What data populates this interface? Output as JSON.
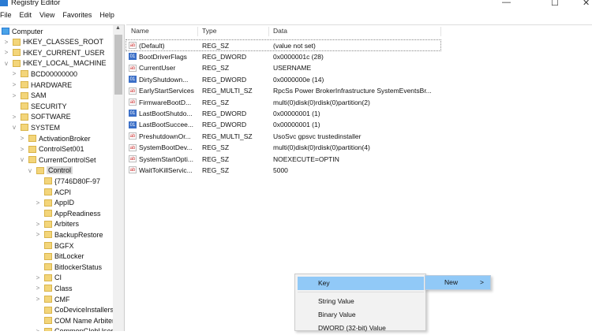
{
  "window": {
    "title": "Registry Editor",
    "minimize": "—",
    "maximize": "☐",
    "close": "✕"
  },
  "menubar": [
    "File",
    "Edit",
    "View",
    "Favorites",
    "Help"
  ],
  "tree": [
    {
      "label": "Computer",
      "level": 0,
      "chev": "",
      "computer": true
    },
    {
      "label": "HKEY_CLASSES_ROOT",
      "level": 1,
      "chev": ">"
    },
    {
      "label": "HKEY_CURRENT_USER",
      "level": 1,
      "chev": ">"
    },
    {
      "label": "HKEY_LOCAL_MACHINE",
      "level": 1,
      "chev": "v"
    },
    {
      "label": "BCD00000000",
      "level": 2,
      "chev": ">"
    },
    {
      "label": "HARDWARE",
      "level": 2,
      "chev": ">"
    },
    {
      "label": "SAM",
      "level": 2,
      "chev": ">"
    },
    {
      "label": "SECURITY",
      "level": 2,
      "chev": ""
    },
    {
      "label": "SOFTWARE",
      "level": 2,
      "chev": ">"
    },
    {
      "label": "SYSTEM",
      "level": 2,
      "chev": "v"
    },
    {
      "label": "ActivationBroker",
      "level": 3,
      "chev": ">"
    },
    {
      "label": "ControlSet001",
      "level": 3,
      "chev": ">"
    },
    {
      "label": "CurrentControlSet",
      "level": 3,
      "chev": "v"
    },
    {
      "label": "Control",
      "level": 4,
      "chev": "v",
      "selected": true
    },
    {
      "label": "{7746D80F-97",
      "level": 5,
      "chev": ""
    },
    {
      "label": "ACPI",
      "level": 5,
      "chev": ""
    },
    {
      "label": "AppID",
      "level": 5,
      "chev": ">"
    },
    {
      "label": "AppReadiness",
      "level": 5,
      "chev": ""
    },
    {
      "label": "Arbiters",
      "level": 5,
      "chev": ">"
    },
    {
      "label": "BackupRestore",
      "level": 5,
      "chev": ">"
    },
    {
      "label": "BGFX",
      "level": 5,
      "chev": ""
    },
    {
      "label": "BitLocker",
      "level": 5,
      "chev": ""
    },
    {
      "label": "BitlockerStatus",
      "level": 5,
      "chev": ""
    },
    {
      "label": "CI",
      "level": 5,
      "chev": ">"
    },
    {
      "label": "Class",
      "level": 5,
      "chev": ">"
    },
    {
      "label": "CMF",
      "level": 5,
      "chev": ">"
    },
    {
      "label": "CoDeviceInstallers",
      "level": 5,
      "chev": ""
    },
    {
      "label": "COM Name Arbiter",
      "level": 5,
      "chev": ""
    },
    {
      "label": "CommonGlobUserSettings",
      "level": 5,
      "chev": ">"
    }
  ],
  "list": {
    "headers": {
      "name": "Name",
      "type": "Type",
      "data": "Data"
    },
    "rows": [
      {
        "name": "(Default)",
        "type": "REG_SZ",
        "data": "(value not set)",
        "icon": "ab"
      },
      {
        "name": "BootDriverFlags",
        "type": "REG_DWORD",
        "data": "0x0000001c (28)",
        "icon": "dw"
      },
      {
        "name": "CurrentUser",
        "type": "REG_SZ",
        "data": "USERNAME",
        "icon": "ab"
      },
      {
        "name": "DirtyShutdown...",
        "type": "REG_DWORD",
        "data": "0x0000000e (14)",
        "icon": "dw"
      },
      {
        "name": "EarlyStartServices",
        "type": "REG_MULTI_SZ",
        "data": "RpcSs Power BrokerInfrastructure SystemEventsBr...",
        "icon": "ab"
      },
      {
        "name": "FirmwareBootD...",
        "type": "REG_SZ",
        "data": "multi(0)disk(0)rdisk(0)partition(2)",
        "icon": "ab"
      },
      {
        "name": "LastBootShutdo...",
        "type": "REG_DWORD",
        "data": "0x00000001 (1)",
        "icon": "dw"
      },
      {
        "name": "LastBootSuccee...",
        "type": "REG_DWORD",
        "data": "0x00000001 (1)",
        "icon": "dw"
      },
      {
        "name": "PreshutdownOr...",
        "type": "REG_MULTI_SZ",
        "data": "UsoSvc gpsvc trustedinstaller",
        "icon": "ab"
      },
      {
        "name": "SystemBootDev...",
        "type": "REG_SZ",
        "data": "multi(0)disk(0)rdisk(0)partition(4)",
        "icon": "ab"
      },
      {
        "name": "SystemStartOpti...",
        "type": "REG_SZ",
        "data": " NOEXECUTE=OPTIN",
        "icon": "ab"
      },
      {
        "name": "WaitToKillServic...",
        "type": "REG_SZ",
        "data": "5000",
        "icon": "ab"
      }
    ]
  },
  "context_menu": {
    "new_label": "New",
    "new_arrow": ">",
    "items": [
      "Key",
      "String Value",
      "Binary Value",
      "DWORD (32-bit) Value"
    ]
  }
}
